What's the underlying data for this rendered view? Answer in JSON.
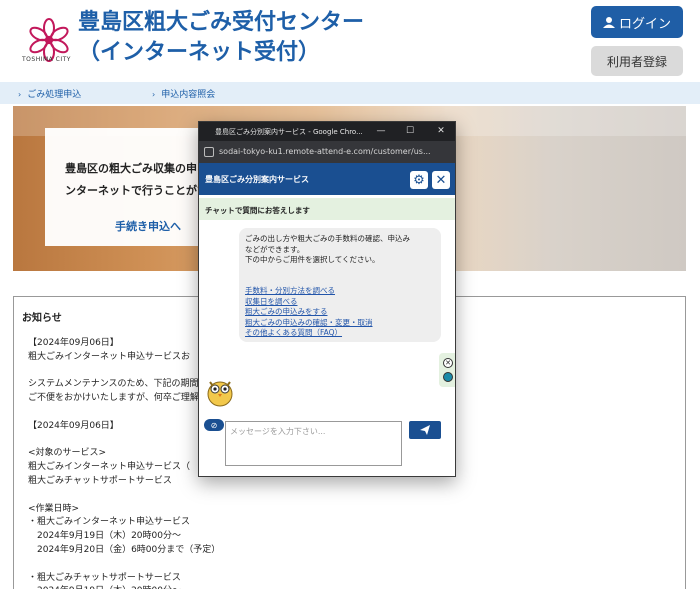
{
  "header": {
    "title_line1": "豊島区粗大ごみ受付センター",
    "title_line2": "（インターネット受付）",
    "logo_caption": "TOSHIMA CITY",
    "login_label": "ログイン",
    "register_label": "利用者登録"
  },
  "nav": {
    "items": [
      {
        "label": "ごみ処理申込"
      },
      {
        "label": "申込内容照会"
      }
    ]
  },
  "hero": {
    "text": "豊島区の粗大ごみ収集の申し\nンターネットで行うことがで",
    "link_label": "手続き申込へ"
  },
  "notice": {
    "title": "お知らせ",
    "body": "【2024年09月06日】\n粗大ごみインターネット申込サービスお\n\nシステムメンテナンスのため、下記の期間\nご不便をおかけいたしますが、何卒ご理解\n\n【2024年09月06日】\n\n<対象のサービス>\n粗大ごみインターネット申込サービス（\n粗大ごみチャットサポートサービス\n\n<作業日時>\n・粗大ごみインターネット申込サービス\n　2024年9月19日（木）20時00分～\n　2024年9月20日（金）6時00分まで（予定）\n\n・粗大ごみチャットサポートサービス\n　2024年9月19日（木）20時00分～"
  },
  "popup": {
    "window_title": "豊島区ごみ分別案内サービス - Google Chro...",
    "url": "sodai-tokyo-ku1.remote-attend-e.com/customer/us...",
    "header_title": "豊島区ごみ分別案内サービス",
    "subheader": "チャットで質問にお答えします",
    "message": "ごみの出し方や粗大ごみの手数料の確認、申込み\nなどができます。\n下の中からご用件を選択してください。",
    "links": [
      "手数料・分別方法を調べる",
      "収集日を調べる",
      "粗大ごみの申込みをする",
      "粗大ごみの申込みの確認・変更・取消",
      "その他よくある質問（FAQ）"
    ],
    "input_placeholder": "メッセージを入力下さい..."
  },
  "colors": {
    "brand_blue": "#1e5fa8",
    "chat_header": "#1a4f91",
    "chat_subheader": "#e4f1e0",
    "popup_border": "#3a3a3a"
  }
}
